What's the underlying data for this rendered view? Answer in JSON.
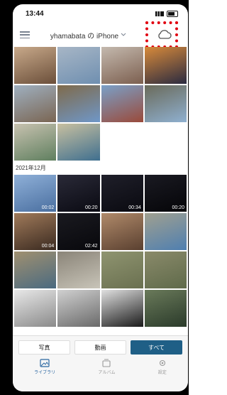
{
  "status": {
    "time": "13:44"
  },
  "header": {
    "device_title": "yhamabata の iPhone"
  },
  "section": {
    "month": "2021年12月"
  },
  "colors": {
    "accent": "#1f5f86",
    "highlight": "#e10010",
    "tab_active": "#2b67a1"
  },
  "photos_top": [
    {
      "dur": "",
      "c1": "#6b4f3a",
      "c2": "#c8a98a"
    },
    {
      "dur": "",
      "c1": "#6f8fb0",
      "c2": "#a7b6c6"
    },
    {
      "dur": "",
      "c1": "#7c5f4f",
      "c2": "#c4b9ae"
    },
    {
      "dur": "",
      "c1": "#2a2a40",
      "c2": "#d88a3a"
    },
    {
      "dur": "",
      "c1": "#7a6552",
      "c2": "#9fb0c0"
    },
    {
      "dur": "",
      "c1": "#6f97c8",
      "c2": "#7f6a4a"
    },
    {
      "dur": "",
      "c1": "#9a4a3a",
      "c2": "#7aa0c8"
    },
    {
      "dur": "",
      "c1": "#8fb0d0",
      "c2": "#6a6a5a"
    },
    {
      "dur": "",
      "c1": "#5f7f5f",
      "c2": "#c8c2b0"
    },
    {
      "dur": "",
      "c1": "#3f6f8f",
      "c2": "#c8c0a0"
    }
  ],
  "photos_dec": [
    {
      "dur": "00:02",
      "c1": "#4a6fa0",
      "c2": "#8fb0d8"
    },
    {
      "dur": "00:20",
      "c1": "#0a0a12",
      "c2": "#2a2a38"
    },
    {
      "dur": "00:34",
      "c1": "#0a0a10",
      "c2": "#1f1f2a"
    },
    {
      "dur": "00:20",
      "c1": "#050508",
      "c2": "#1a1a22"
    },
    {
      "dur": "00:04",
      "c1": "#3a2a20",
      "c2": "#a07a5a"
    },
    {
      "dur": "02:42",
      "c1": "#08080c",
      "c2": "#1a1a20"
    },
    {
      "dur": "",
      "c1": "#5a4030",
      "c2": "#b08a6a"
    },
    {
      "dur": "",
      "c1": "#4f7fb0",
      "c2": "#a0a090"
    },
    {
      "dur": "",
      "c1": "#4a6a80",
      "c2": "#a09070"
    },
    {
      "dur": "",
      "c1": "#c8c4b8",
      "c2": "#8a8478"
    },
    {
      "dur": "",
      "c1": "#6a7050",
      "c2": "#8f9470"
    },
    {
      "dur": "",
      "c1": "#5f6a4a",
      "c2": "#8a8a6a"
    },
    {
      "dur": "",
      "c1": "#8a8a8a",
      "c2": "#e8e8e8"
    },
    {
      "dur": "",
      "c1": "#6a6a6a",
      "c2": "#d0d0d0"
    },
    {
      "dur": "",
      "c1": "#1a1a1a",
      "c2": "#e0e0e0"
    },
    {
      "dur": "",
      "c1": "#2a3a2a",
      "c2": "#6a7a5a"
    }
  ],
  "segments": [
    "写真",
    "動画",
    "すべて"
  ],
  "tabs": [
    "ライブラリ",
    "アルバム",
    "設定"
  ]
}
